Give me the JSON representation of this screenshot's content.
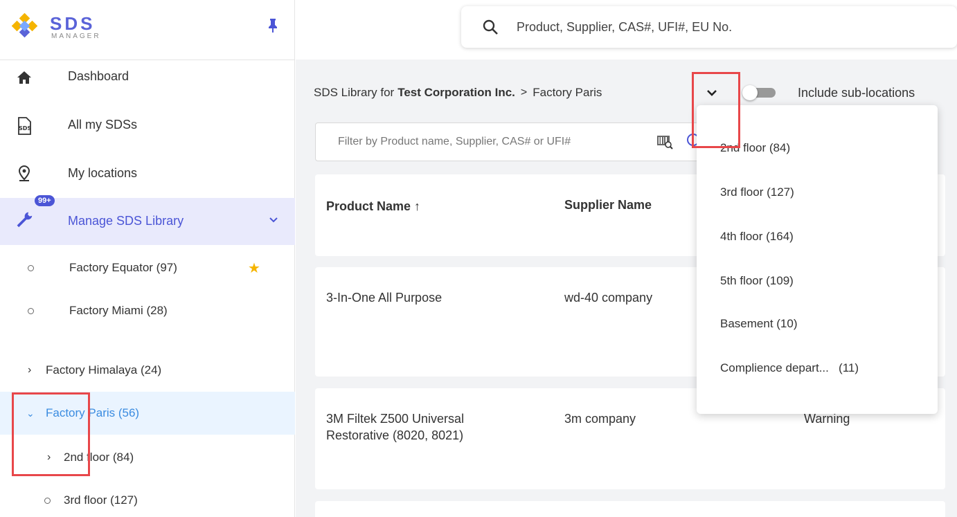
{
  "logo": {
    "title": "SDS",
    "subtitle": "MANAGER"
  },
  "search": {
    "placeholder": "Product, Supplier, CAS#, UFI#, EU No."
  },
  "sidebar": {
    "nav": [
      {
        "label": "Dashboard",
        "icon": "home-icon"
      },
      {
        "label": "All my SDSs",
        "icon": "sds-document-icon"
      },
      {
        "label": "My locations",
        "icon": "location-pin-icon"
      },
      {
        "label": "Manage SDS Library",
        "icon": "wrench-icon",
        "badge": "99+"
      }
    ],
    "favorites": [
      {
        "label": "Factory Equator (97)",
        "starred": true
      },
      {
        "label": "Factory Miami (28)",
        "starred": false
      }
    ],
    "tree": [
      {
        "label": "Factory Himalaya (24)",
        "chevron": "›"
      },
      {
        "label": "Factory Paris (56)",
        "chevron": "⌄"
      },
      {
        "label": "2nd floor (84)",
        "chevron": "›"
      },
      {
        "label": "3rd floor (127)",
        "chevron": "○"
      }
    ]
  },
  "breadcrumb": {
    "prefix": "SDS Library for",
    "company": "Test Corporation Inc.",
    "separator": ">",
    "location": "Factory Paris"
  },
  "toggle": {
    "label": "Include sub-locations",
    "on": false
  },
  "filter": {
    "placeholder": "Filter by Product name, Supplier, CAS# or UFI#"
  },
  "table": {
    "headers": {
      "product": "Product Name",
      "supplier": "Supplier Name",
      "sort_arrow": "↑"
    },
    "rows": [
      {
        "product": "3-In-One All Purpose",
        "supplier": "wd-40 company",
        "signal": ""
      },
      {
        "product": "3M Filtek Z500 Universal\nRestorative (8020, 8021)",
        "supplier": "3m company",
        "signal": "Warning"
      }
    ]
  },
  "dropdown": {
    "items": [
      "2nd floor (84)",
      "3rd floor (127)",
      "4th floor (164)",
      "5th floor (109)",
      "Basement (10)",
      "Complience depart...   (11)"
    ]
  },
  "colors": {
    "accent": "#4b55d6",
    "highlight": "#e8474a",
    "selected_bg": "#eaf4ff",
    "active_bg": "#e9eafc"
  }
}
